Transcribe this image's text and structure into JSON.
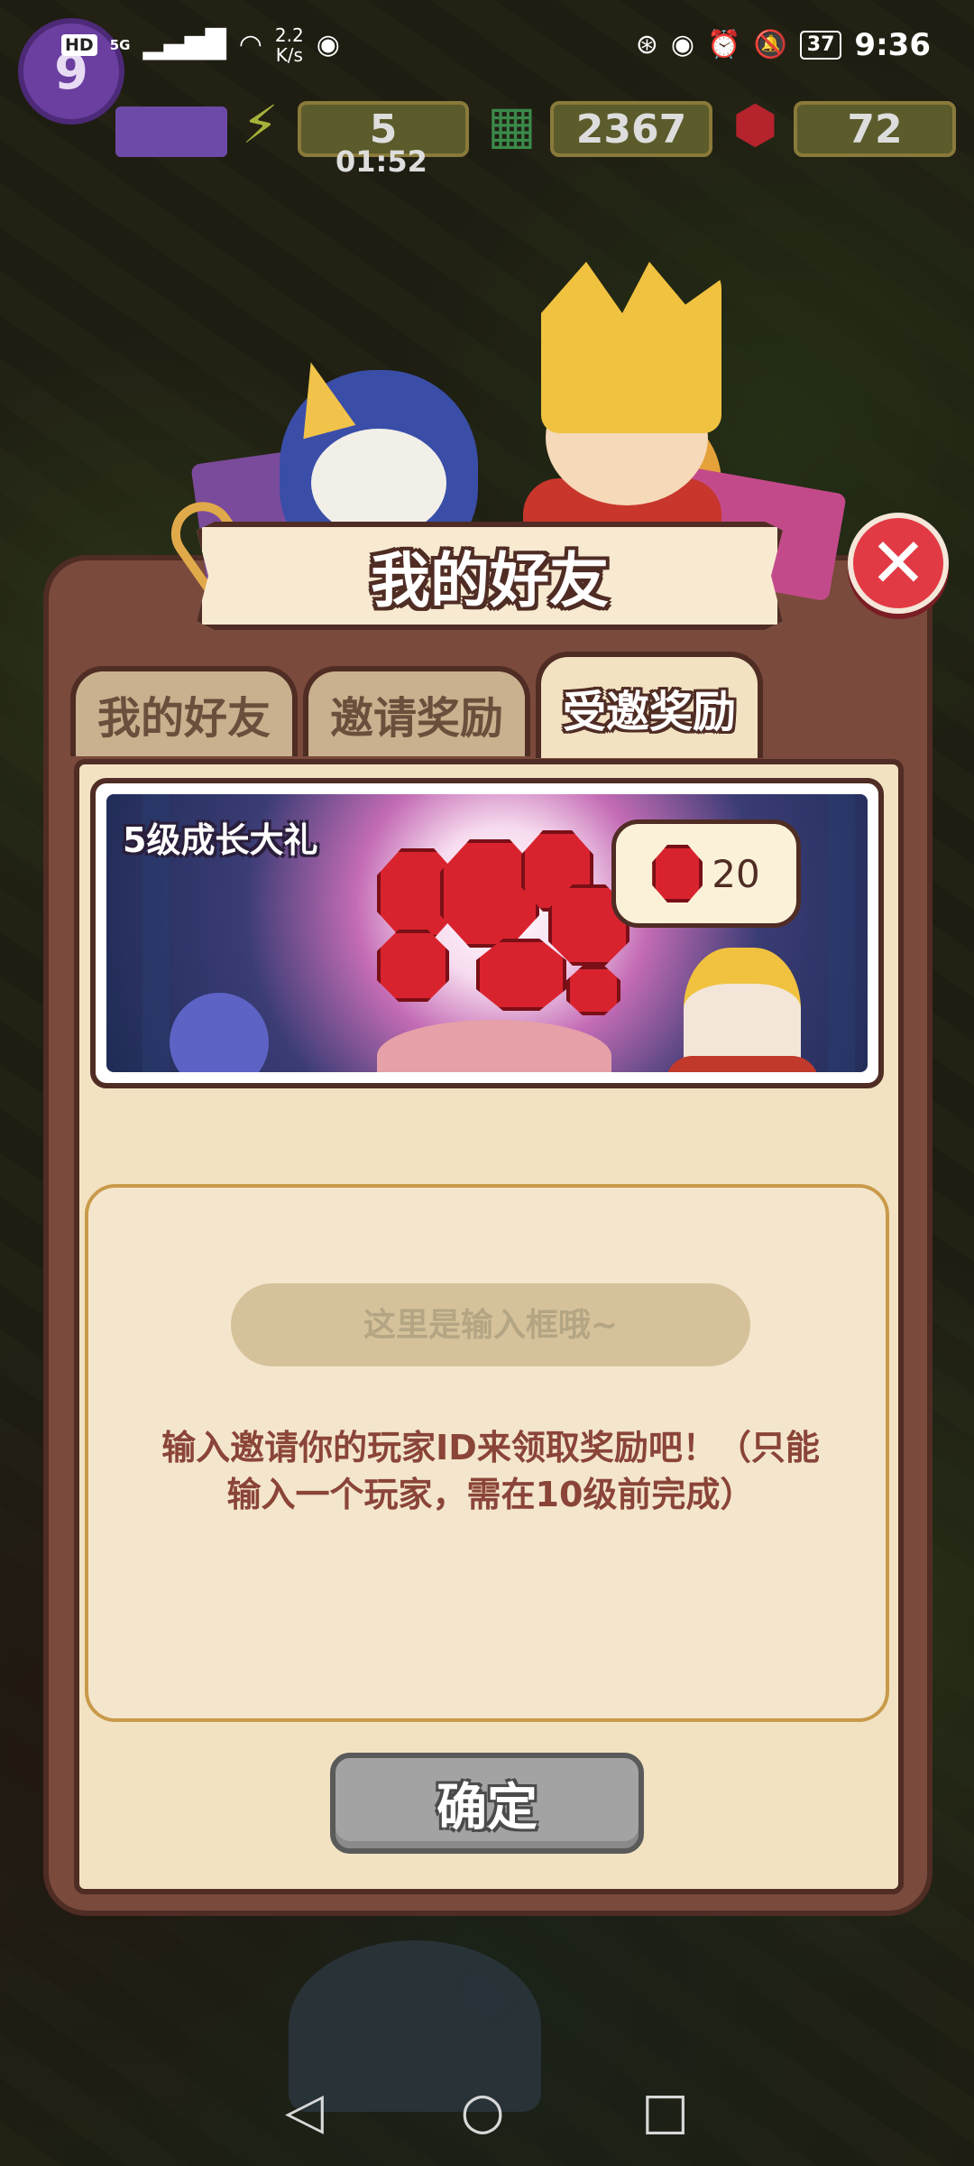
{
  "status_bar": {
    "hd": "HD",
    "network": "5G",
    "speed": "2.2\nK/s",
    "battery": "37",
    "time": "9:36"
  },
  "hud": {
    "level": "9",
    "energy": "5",
    "energy_timer": "01:52",
    "cash": "2367",
    "gems": "72"
  },
  "dialog": {
    "title": "我的好友",
    "tabs": [
      {
        "label": "我的好友",
        "active": false
      },
      {
        "label": "邀请奖励",
        "active": false
      },
      {
        "label": "受邀奖励",
        "active": true
      }
    ],
    "reward": {
      "title": "5级成长大礼",
      "gem_count": "20"
    },
    "input": {
      "placeholder": "这里是输入框哦~"
    },
    "hint": "输入邀请你的玩家ID来领取奖励吧！（只能输入一个玩家，需在10级前完成）",
    "confirm_label": "确定"
  },
  "icons": {
    "close": "close-icon",
    "energy": "lightning-icon",
    "cash": "cash-icon",
    "gem": "gem-icon"
  },
  "colors": {
    "dialog_frame": "#7a4a3c",
    "dialog_inner": "#f2e2c2",
    "close_red": "#e23a44",
    "confirm_gray": "#a3a3a3",
    "hint_text": "#8a4438"
  }
}
